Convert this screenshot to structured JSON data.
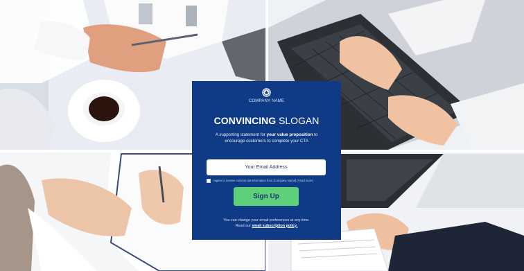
{
  "card": {
    "company_name": "COMPANY NAME",
    "slogan_bold": "CONVINCING",
    "slogan_rest": " SLOGAN",
    "support_prefix": "A supporting statement for ",
    "support_bold": "your value proposition",
    "support_mid": " to",
    "support_line2": "encourage customers to complete your CTA",
    "email_placeholder": "Your Email Address",
    "consent_text": "I agree to receive commercial information from [Company Name] (*read more)",
    "signup_label": "Sign Up",
    "footer_line1": "You can change your email preferences at any time.",
    "footer_line2_prefix": "Read our ",
    "footer_policy_link": "email subscription policy."
  },
  "colors": {
    "card_bg": "#0f3a86",
    "button_bg": "#5fd07a"
  },
  "icons": {
    "logo": "company-emblem-icon"
  }
}
